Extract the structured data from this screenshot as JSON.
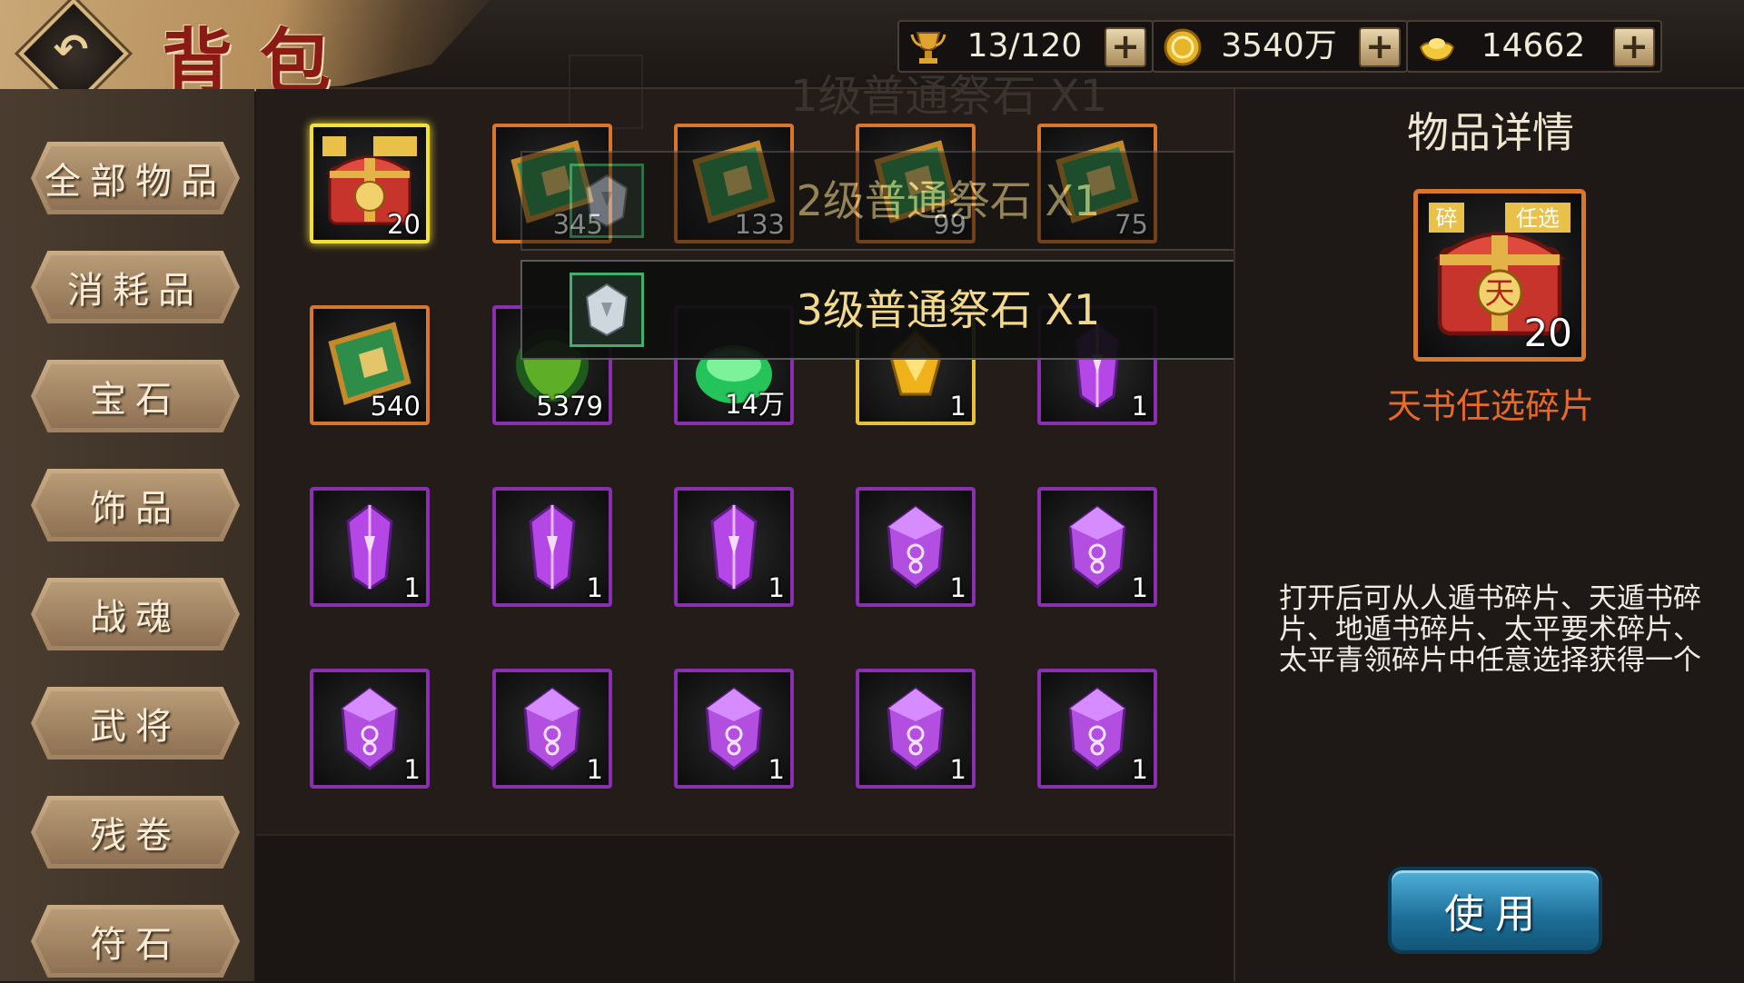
{
  "header": {
    "title": "背包",
    "back_icon": "back-arrow-icon"
  },
  "resources": [
    {
      "icon": "trophy-icon",
      "value": "13/120"
    },
    {
      "icon": "gold-coin-icon",
      "value": "3540万"
    },
    {
      "icon": "gold-ingot-icon",
      "value": "14662"
    }
  ],
  "sidebar": {
    "items": [
      {
        "label": "全部物品"
      },
      {
        "label": "消耗品"
      },
      {
        "label": "宝石"
      },
      {
        "label": "饰品"
      },
      {
        "label": "战魂"
      },
      {
        "label": "武将"
      },
      {
        "label": "残卷"
      },
      {
        "label": "符石"
      }
    ]
  },
  "grid": {
    "items": [
      {
        "icon": "treasure-chest-icon",
        "count": "20",
        "rarity": "orange",
        "selected": true
      },
      {
        "icon": "book-icon",
        "count": "345",
        "rarity": "orange"
      },
      {
        "icon": "book-icon",
        "count": "133",
        "rarity": "orange"
      },
      {
        "icon": "book-icon",
        "count": "99",
        "rarity": "orange"
      },
      {
        "icon": "book-icon",
        "count": "75",
        "rarity": "orange"
      },
      {
        "icon": "book-icon",
        "count": "540",
        "rarity": "orange"
      },
      {
        "icon": "scroll-icon",
        "count": "5379",
        "rarity": "purple"
      },
      {
        "icon": "green-gem-icon",
        "count": "14万",
        "rarity": "purple"
      },
      {
        "icon": "yellow-gem-icon",
        "count": "1",
        "rarity": "yellow"
      },
      {
        "icon": "purple-crystal-icon",
        "count": "1",
        "rarity": "purple"
      },
      {
        "icon": "purple-crystal-icon",
        "count": "1",
        "rarity": "purple"
      },
      {
        "icon": "purple-crystal-icon",
        "count": "1",
        "rarity": "purple"
      },
      {
        "icon": "purple-crystal-icon",
        "count": "1",
        "rarity": "purple"
      },
      {
        "icon": "purple-rune-stone-icon",
        "count": "1",
        "rarity": "purple"
      },
      {
        "icon": "purple-rune-stone-icon",
        "count": "1",
        "rarity": "purple"
      },
      {
        "icon": "purple-rune-stone-icon",
        "count": "1",
        "rarity": "purple"
      },
      {
        "icon": "purple-rune-stone-icon",
        "count": "1",
        "rarity": "purple"
      },
      {
        "icon": "purple-rune-stone-icon",
        "count": "1",
        "rarity": "purple"
      },
      {
        "icon": "purple-rune-stone-icon",
        "count": "1",
        "rarity": "purple"
      },
      {
        "icon": "purple-rune-stone-icon",
        "count": "1",
        "rarity": "purple"
      }
    ]
  },
  "popups": [
    {
      "text": "1级普通祭石 X1"
    },
    {
      "text": "2级普通祭石 X1"
    },
    {
      "text": "3级普通祭石 X1"
    }
  ],
  "detail": {
    "title": "物品详情",
    "item_name": "天书任选碎片",
    "item_count": "20",
    "description": "打开后可从人遁书碎片、天遁书碎片、地遁书碎片、太平要术碎片、太平青领碎片中任意选择获得一个",
    "use_label": "使用"
  },
  "colors": {
    "orange_frame": "#d8762c",
    "purple_frame": "#8a2fb1",
    "yellow_frame": "#e5c13a",
    "item_name": "#e8692a",
    "popup_text": "#f2d98c",
    "use_button": "#1d6e98"
  }
}
